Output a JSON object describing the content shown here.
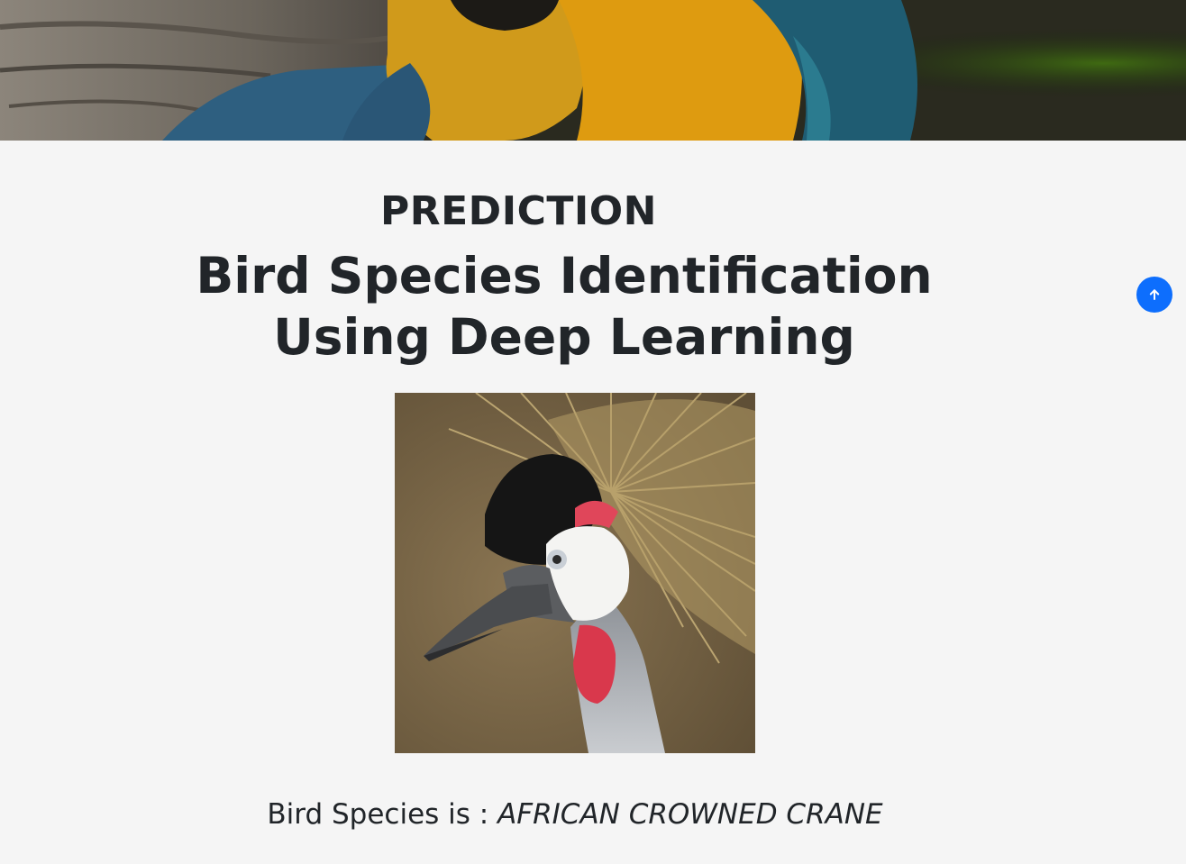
{
  "hero": {
    "image": "macaw-birds-banner"
  },
  "prediction": {
    "heading": "PREDICTION",
    "project_title": "Bird Species Identification Using Deep Learning",
    "image": "african-crowned-crane-photo",
    "result_label": "Bird Species is :",
    "result_value": "AFRICAN CROWNED CRANE"
  },
  "controls": {
    "back_to_top_icon": "arrow-up-icon"
  },
  "colors": {
    "page_background": "#f5f5f5",
    "text": "#212529",
    "accent_blue": "#0d6efd"
  }
}
